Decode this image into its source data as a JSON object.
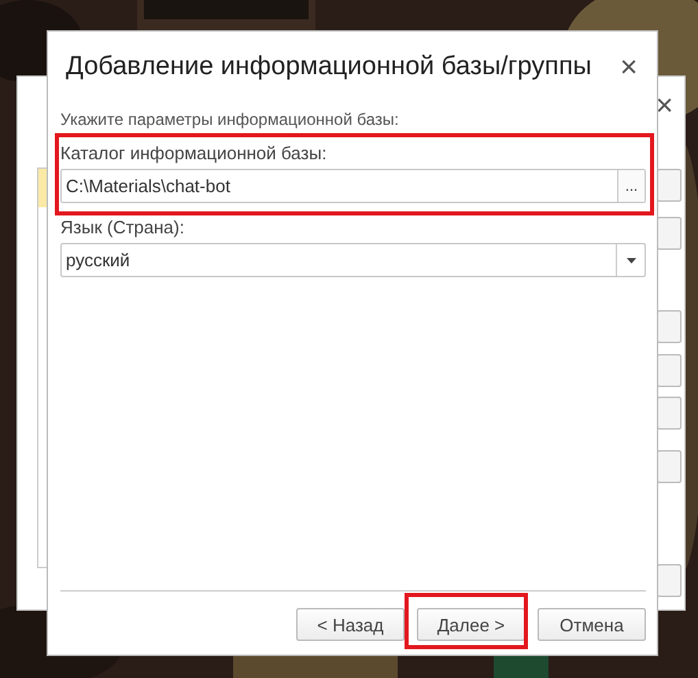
{
  "back_window": {
    "close": "×"
  },
  "dialog": {
    "title": "Добавление информационной базы/группы",
    "close": "×",
    "hint": "Укажите параметры информационной базы:",
    "fields": [
      {
        "kind": "path",
        "label": "Каталог информационной базы:",
        "value": "C:\\Materials\\chat-bot",
        "button": "...",
        "highlighted": true
      },
      {
        "kind": "select",
        "label": "Язык (Страна):",
        "value": "русский",
        "highlighted": false
      }
    ],
    "buttons": [
      {
        "label": "< Назад",
        "highlighted": false
      },
      {
        "label": "Далее >",
        "highlighted": true
      },
      {
        "label": "Отмена",
        "highlighted": false
      }
    ]
  }
}
